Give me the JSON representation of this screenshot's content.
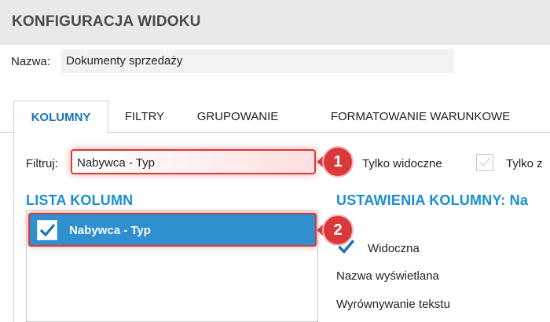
{
  "title": "KONFIGURACJA WIDOKU",
  "name_field": {
    "label": "Nazwa:",
    "value": "Dokumenty sprzedaży"
  },
  "tabs": [
    {
      "label": "KOLUMNY",
      "active": true
    },
    {
      "label": "FILTRY",
      "active": false
    },
    {
      "label": "GRUPOWANIE",
      "active": false
    },
    {
      "label": "FORMATOWANIE WARUNKOWE",
      "active": false
    }
  ],
  "filter": {
    "label": "Filtruj:",
    "value": "Nabywca - Typ"
  },
  "options": {
    "only_visible": {
      "label": "Tylko widoczne",
      "checked": true
    },
    "only_other": {
      "label": "Tylko z",
      "checked": false
    }
  },
  "columns_list": {
    "title": "LISTA KOLUMN",
    "items": [
      {
        "label": "Nabywca - Typ",
        "checked": true,
        "selected": true
      }
    ]
  },
  "column_settings": {
    "title": "USTAWIENIA KOLUMNY: Na",
    "visible_label": "Widoczna",
    "display_name_label": "Nazwa wyświetlana",
    "text_align_label": "Wyrównywanie tekstu"
  },
  "annotations": {
    "badge_1": "1",
    "badge_2": "2"
  },
  "colors": {
    "accent": "#1a8fd0",
    "selected_row": "#2f8fcf",
    "highlight": "#d63a3a",
    "check": "#1a73b8"
  }
}
